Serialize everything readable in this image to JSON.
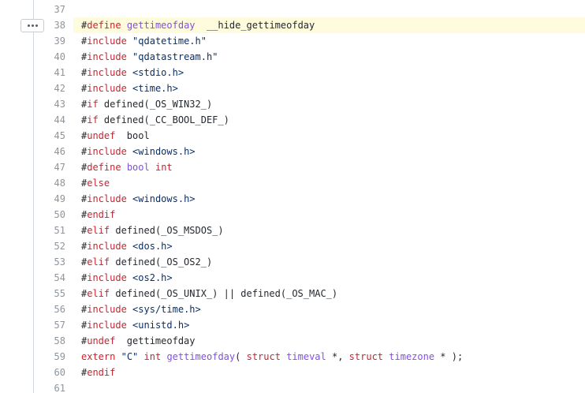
{
  "viewer": {
    "expand_button_label": "Expand hidden lines",
    "highlight_line": 38
  },
  "lines": [
    {
      "n": "37",
      "tokens": []
    },
    {
      "n": "38",
      "tokens": [
        {
          "c": "t-plain",
          "t": "#"
        },
        {
          "c": "t-kw",
          "t": "define"
        },
        {
          "c": "t-plain",
          "t": " "
        },
        {
          "c": "t-macro",
          "t": "gettimeofday"
        },
        {
          "c": "t-plain",
          "t": "  __hide_gettimeofday"
        }
      ]
    },
    {
      "n": "39",
      "tokens": [
        {
          "c": "t-plain",
          "t": "#"
        },
        {
          "c": "t-kw",
          "t": "include"
        },
        {
          "c": "t-plain",
          "t": " "
        },
        {
          "c": "t-str",
          "t": "\"qdatetime.h\""
        }
      ]
    },
    {
      "n": "40",
      "tokens": [
        {
          "c": "t-plain",
          "t": "#"
        },
        {
          "c": "t-kw",
          "t": "include"
        },
        {
          "c": "t-plain",
          "t": " "
        },
        {
          "c": "t-str",
          "t": "\"qdatastream.h\""
        }
      ]
    },
    {
      "n": "41",
      "tokens": [
        {
          "c": "t-plain",
          "t": "#"
        },
        {
          "c": "t-kw",
          "t": "include"
        },
        {
          "c": "t-plain",
          "t": " "
        },
        {
          "c": "t-str",
          "t": "<stdio.h>"
        }
      ]
    },
    {
      "n": "42",
      "tokens": [
        {
          "c": "t-plain",
          "t": "#"
        },
        {
          "c": "t-kw",
          "t": "include"
        },
        {
          "c": "t-plain",
          "t": " "
        },
        {
          "c": "t-str",
          "t": "<time.h>"
        }
      ]
    },
    {
      "n": "43",
      "tokens": [
        {
          "c": "t-plain",
          "t": "#"
        },
        {
          "c": "t-kw",
          "t": "if"
        },
        {
          "c": "t-plain",
          "t": " defined(_OS_WIN32_)"
        }
      ]
    },
    {
      "n": "44",
      "tokens": [
        {
          "c": "t-plain",
          "t": "#"
        },
        {
          "c": "t-kw",
          "t": "if"
        },
        {
          "c": "t-plain",
          "t": " defined(_CC_BOOL_DEF_)"
        }
      ]
    },
    {
      "n": "45",
      "tokens": [
        {
          "c": "t-plain",
          "t": "#"
        },
        {
          "c": "t-kw",
          "t": "undef"
        },
        {
          "c": "t-plain",
          "t": "  bool"
        }
      ]
    },
    {
      "n": "46",
      "tokens": [
        {
          "c": "t-plain",
          "t": "#"
        },
        {
          "c": "t-kw",
          "t": "include"
        },
        {
          "c": "t-plain",
          "t": " "
        },
        {
          "c": "t-str",
          "t": "<windows.h>"
        }
      ]
    },
    {
      "n": "47",
      "tokens": [
        {
          "c": "t-plain",
          "t": "#"
        },
        {
          "c": "t-kw",
          "t": "define"
        },
        {
          "c": "t-plain",
          "t": " "
        },
        {
          "c": "t-macro",
          "t": "bool"
        },
        {
          "c": "t-plain",
          "t": " "
        },
        {
          "c": "t-kw",
          "t": "int"
        }
      ]
    },
    {
      "n": "48",
      "tokens": [
        {
          "c": "t-plain",
          "t": "#"
        },
        {
          "c": "t-kw",
          "t": "else"
        }
      ]
    },
    {
      "n": "49",
      "tokens": [
        {
          "c": "t-plain",
          "t": "#"
        },
        {
          "c": "t-kw",
          "t": "include"
        },
        {
          "c": "t-plain",
          "t": " "
        },
        {
          "c": "t-str",
          "t": "<windows.h>"
        }
      ]
    },
    {
      "n": "50",
      "tokens": [
        {
          "c": "t-plain",
          "t": "#"
        },
        {
          "c": "t-kw",
          "t": "endif"
        }
      ]
    },
    {
      "n": "51",
      "tokens": [
        {
          "c": "t-plain",
          "t": "#"
        },
        {
          "c": "t-kw",
          "t": "elif"
        },
        {
          "c": "t-plain",
          "t": " defined(_OS_MSDOS_)"
        }
      ]
    },
    {
      "n": "52",
      "tokens": [
        {
          "c": "t-plain",
          "t": "#"
        },
        {
          "c": "t-kw",
          "t": "include"
        },
        {
          "c": "t-plain",
          "t": " "
        },
        {
          "c": "t-str",
          "t": "<dos.h>"
        }
      ]
    },
    {
      "n": "53",
      "tokens": [
        {
          "c": "t-plain",
          "t": "#"
        },
        {
          "c": "t-kw",
          "t": "elif"
        },
        {
          "c": "t-plain",
          "t": " defined(_OS_OS2_)"
        }
      ]
    },
    {
      "n": "54",
      "tokens": [
        {
          "c": "t-plain",
          "t": "#"
        },
        {
          "c": "t-kw",
          "t": "include"
        },
        {
          "c": "t-plain",
          "t": " "
        },
        {
          "c": "t-str",
          "t": "<os2.h>"
        }
      ]
    },
    {
      "n": "55",
      "tokens": [
        {
          "c": "t-plain",
          "t": "#"
        },
        {
          "c": "t-kw",
          "t": "elif"
        },
        {
          "c": "t-plain",
          "t": " defined(_OS_UNIX_) || defined(_OS_MAC_)"
        }
      ]
    },
    {
      "n": "56",
      "tokens": [
        {
          "c": "t-plain",
          "t": "#"
        },
        {
          "c": "t-kw",
          "t": "include"
        },
        {
          "c": "t-plain",
          "t": " "
        },
        {
          "c": "t-str",
          "t": "<sys/time.h>"
        }
      ]
    },
    {
      "n": "57",
      "tokens": [
        {
          "c": "t-plain",
          "t": "#"
        },
        {
          "c": "t-kw",
          "t": "include"
        },
        {
          "c": "t-plain",
          "t": " "
        },
        {
          "c": "t-str",
          "t": "<unistd.h>"
        }
      ]
    },
    {
      "n": "58",
      "tokens": [
        {
          "c": "t-plain",
          "t": "#"
        },
        {
          "c": "t-kw",
          "t": "undef"
        },
        {
          "c": "t-plain",
          "t": "  gettimeofday"
        }
      ]
    },
    {
      "n": "59",
      "tokens": [
        {
          "c": "t-kw",
          "t": "extern"
        },
        {
          "c": "t-plain",
          "t": " "
        },
        {
          "c": "t-str",
          "t": "\"C\""
        },
        {
          "c": "t-plain",
          "t": " "
        },
        {
          "c": "t-kw",
          "t": "int"
        },
        {
          "c": "t-plain",
          "t": " "
        },
        {
          "c": "t-macro",
          "t": "gettimeofday"
        },
        {
          "c": "t-plain",
          "t": "( "
        },
        {
          "c": "t-kw",
          "t": "struct"
        },
        {
          "c": "t-plain",
          "t": " "
        },
        {
          "c": "t-type",
          "t": "timeval"
        },
        {
          "c": "t-plain",
          "t": " *, "
        },
        {
          "c": "t-kw",
          "t": "struct"
        },
        {
          "c": "t-plain",
          "t": " "
        },
        {
          "c": "t-type",
          "t": "timezone"
        },
        {
          "c": "t-plain",
          "t": " * );"
        }
      ]
    },
    {
      "n": "60",
      "tokens": [
        {
          "c": "t-plain",
          "t": "#"
        },
        {
          "c": "t-kw",
          "t": "endif"
        }
      ]
    },
    {
      "n": "61",
      "tokens": []
    }
  ]
}
